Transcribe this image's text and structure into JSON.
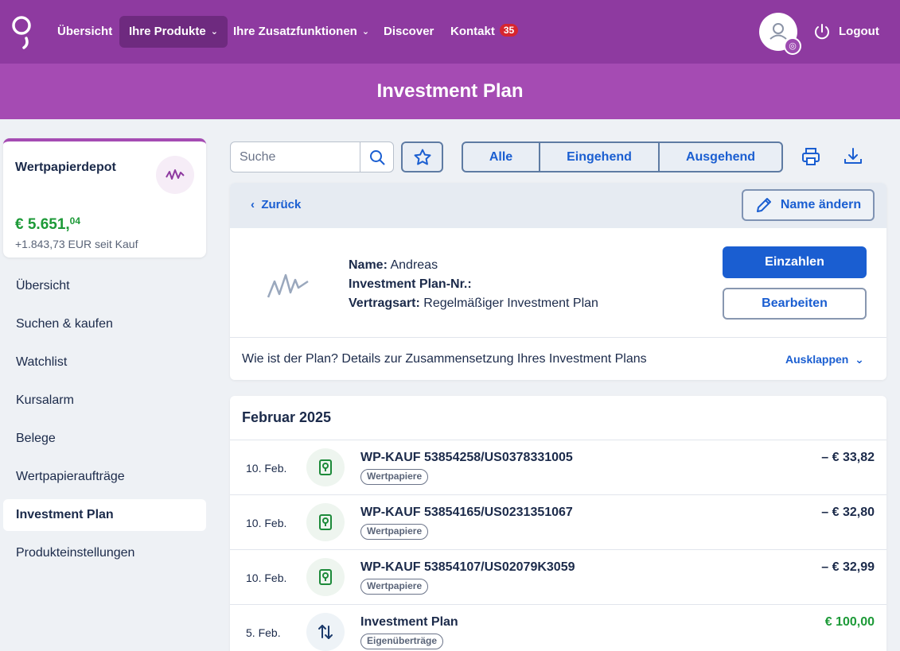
{
  "nav": {
    "items": [
      {
        "label": "Übersicht"
      },
      {
        "label": "Ihre Produkte"
      },
      {
        "label": "Ihre Zusatzfunktionen"
      },
      {
        "label": "Discover"
      },
      {
        "label": "Kontakt"
      }
    ],
    "kontakt_badge": "35",
    "logout_label": "Logout"
  },
  "banner": {
    "title": "Investment Plan"
  },
  "depot": {
    "title": "Wertpapierdepot",
    "value_main": "€ 5.651,",
    "value_cents": "04",
    "change": "+1.843,73 EUR seit Kauf"
  },
  "sidebar": {
    "items": [
      {
        "label": "Übersicht"
      },
      {
        "label": "Suchen & kaufen"
      },
      {
        "label": "Watchlist"
      },
      {
        "label": "Kursalarm"
      },
      {
        "label": "Belege"
      },
      {
        "label": "Wertpapieraufträge"
      },
      {
        "label": "Investment Plan"
      },
      {
        "label": "Produkteinstellungen"
      }
    ]
  },
  "toolbar": {
    "search_placeholder": "Suche",
    "filters": [
      "Alle",
      "Eingehend",
      "Ausgehend"
    ]
  },
  "detail": {
    "back_label": "Zurück",
    "rename_label": "Name ändern",
    "name_label": "Name:",
    "name_value": "Andreas",
    "plan_nr_label": "Investment Plan-Nr.:",
    "plan_nr_value": "",
    "contract_label": "Vertragsart:",
    "contract_value": "Regelmäßiger Investment Plan",
    "deposit_label": "Einzahlen",
    "edit_label": "Bearbeiten",
    "question": "Wie ist der Plan? Details zur Zusammensetzung Ihres Investment Plans",
    "expand_label": "Ausklappen"
  },
  "transactions": {
    "month": "Februar 2025",
    "rows": [
      {
        "date": "10. Feb.",
        "title": "WP-KAUF 53854258/US0378331005",
        "tag": "Wertpapiere",
        "amount": "– € 33,82",
        "icon": "security-icon"
      },
      {
        "date": "10. Feb.",
        "title": "WP-KAUF 53854165/US0231351067",
        "tag": "Wertpapiere",
        "amount": "– € 32,80",
        "icon": "security-icon"
      },
      {
        "date": "10. Feb.",
        "title": "WP-KAUF 53854107/US02079K3059",
        "tag": "Wertpapiere",
        "amount": "– € 32,99",
        "icon": "security-icon"
      },
      {
        "date": "5. Feb.",
        "title": "Investment Plan",
        "tag": "Eigenüberträge",
        "amount": "€ 100,00",
        "icon": "transfer-icon"
      }
    ]
  },
  "colors": {
    "nav_bg": "#8e3aa0",
    "banner_bg": "#a54bb3",
    "primary": "#1a5ed1",
    "positive": "#1d9a38"
  }
}
